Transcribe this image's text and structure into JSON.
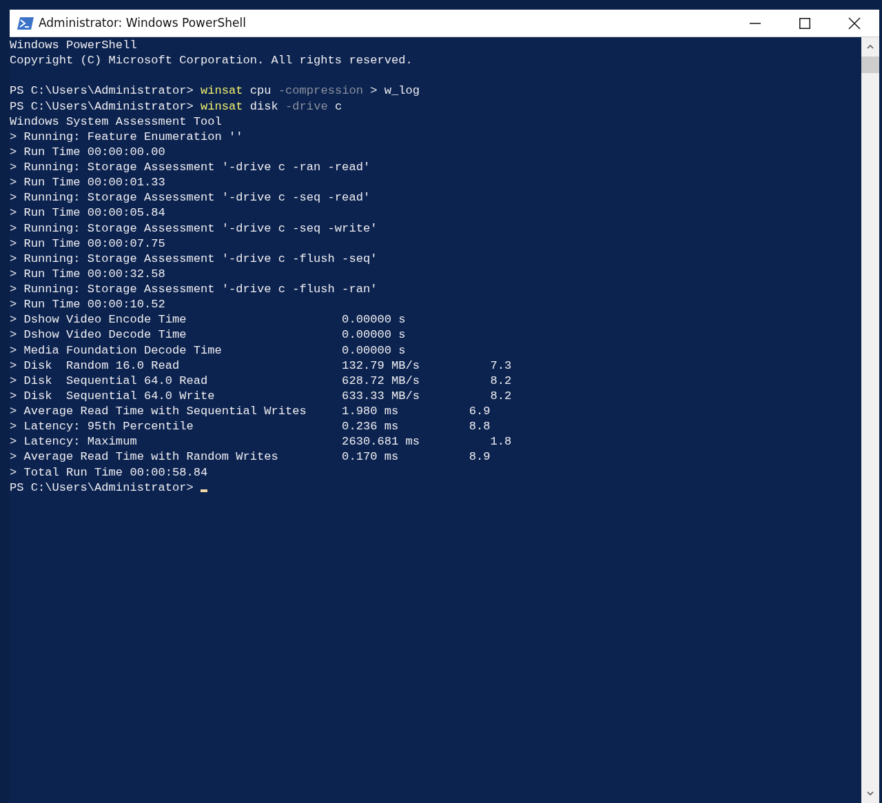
{
  "window": {
    "title": "Administrator: Windows PowerShell"
  },
  "console": {
    "lines": [
      {
        "segments": [
          {
            "kind": "plain",
            "text": "Windows PowerShell"
          }
        ]
      },
      {
        "segments": [
          {
            "kind": "plain",
            "text": "Copyright (C) Microsoft Corporation. All rights reserved."
          }
        ]
      },
      {
        "kind": "blank"
      },
      {
        "segments": [
          {
            "kind": "plain",
            "text": "PS C:\\Users\\Administrator> "
          },
          {
            "kind": "command",
            "text": "winsat"
          },
          {
            "kind": "plain",
            "text": " cpu "
          },
          {
            "kind": "parameter",
            "text": "-compression"
          },
          {
            "kind": "plain",
            "text": " > w_log"
          }
        ]
      },
      {
        "segments": [
          {
            "kind": "plain",
            "text": "PS C:\\Users\\Administrator> "
          },
          {
            "kind": "command",
            "text": "winsat"
          },
          {
            "kind": "plain",
            "text": " disk "
          },
          {
            "kind": "parameter",
            "text": "-drive"
          },
          {
            "kind": "plain",
            "text": " c"
          }
        ]
      },
      {
        "segments": [
          {
            "kind": "plain",
            "text": "Windows System Assessment Tool"
          }
        ]
      },
      {
        "segments": [
          {
            "kind": "plain",
            "text": "> Running: Feature Enumeration ''"
          }
        ]
      },
      {
        "segments": [
          {
            "kind": "plain",
            "text": "> Run Time 00:00:00.00"
          }
        ]
      },
      {
        "segments": [
          {
            "kind": "plain",
            "text": "> Running: Storage Assessment '-drive c -ran -read'"
          }
        ]
      },
      {
        "segments": [
          {
            "kind": "plain",
            "text": "> Run Time 00:00:01.33"
          }
        ]
      },
      {
        "segments": [
          {
            "kind": "plain",
            "text": "> Running: Storage Assessment '-drive c -seq -read'"
          }
        ]
      },
      {
        "segments": [
          {
            "kind": "plain",
            "text": "> Run Time 00:00:05.84"
          }
        ]
      },
      {
        "segments": [
          {
            "kind": "plain",
            "text": "> Running: Storage Assessment '-drive c -seq -write'"
          }
        ]
      },
      {
        "segments": [
          {
            "kind": "plain",
            "text": "> Run Time 00:00:07.75"
          }
        ]
      },
      {
        "segments": [
          {
            "kind": "plain",
            "text": "> Running: Storage Assessment '-drive c -flush -seq'"
          }
        ]
      },
      {
        "segments": [
          {
            "kind": "plain",
            "text": "> Run Time 00:00:32.58"
          }
        ]
      },
      {
        "segments": [
          {
            "kind": "plain",
            "text": "> Running: Storage Assessment '-drive c -flush -ran'"
          }
        ]
      },
      {
        "segments": [
          {
            "kind": "plain",
            "text": "> Run Time 00:00:10.52"
          }
        ]
      },
      {
        "segments": [
          {
            "kind": "plain",
            "text": "> Dshow Video Encode Time                      0.00000 s"
          }
        ]
      },
      {
        "segments": [
          {
            "kind": "plain",
            "text": "> Dshow Video Decode Time                      0.00000 s"
          }
        ]
      },
      {
        "segments": [
          {
            "kind": "plain",
            "text": "> Media Foundation Decode Time                 0.00000 s"
          }
        ]
      },
      {
        "segments": [
          {
            "kind": "plain",
            "text": "> Disk  Random 16.0 Read                       132.79 MB/s          7.3"
          }
        ]
      },
      {
        "segments": [
          {
            "kind": "plain",
            "text": "> Disk  Sequential 64.0 Read                   628.72 MB/s          8.2"
          }
        ]
      },
      {
        "segments": [
          {
            "kind": "plain",
            "text": "> Disk  Sequential 64.0 Write                  633.33 MB/s          8.2"
          }
        ]
      },
      {
        "segments": [
          {
            "kind": "plain",
            "text": "> Average Read Time with Sequential Writes     1.980 ms          6.9"
          }
        ]
      },
      {
        "segments": [
          {
            "kind": "plain",
            "text": "> Latency: 95th Percentile                     0.236 ms          8.8"
          }
        ]
      },
      {
        "segments": [
          {
            "kind": "plain",
            "text": "> Latency: Maximum                             2630.681 ms          1.8"
          }
        ]
      },
      {
        "segments": [
          {
            "kind": "plain",
            "text": "> Average Read Time with Random Writes         0.170 ms          8.9"
          }
        ]
      },
      {
        "segments": [
          {
            "kind": "plain",
            "text": "> Total Run Time 00:00:58.84"
          }
        ]
      },
      {
        "segments": [
          {
            "kind": "plain",
            "text": "PS C:\\Users\\Administrator> "
          }
        ],
        "cursor": true
      }
    ]
  }
}
